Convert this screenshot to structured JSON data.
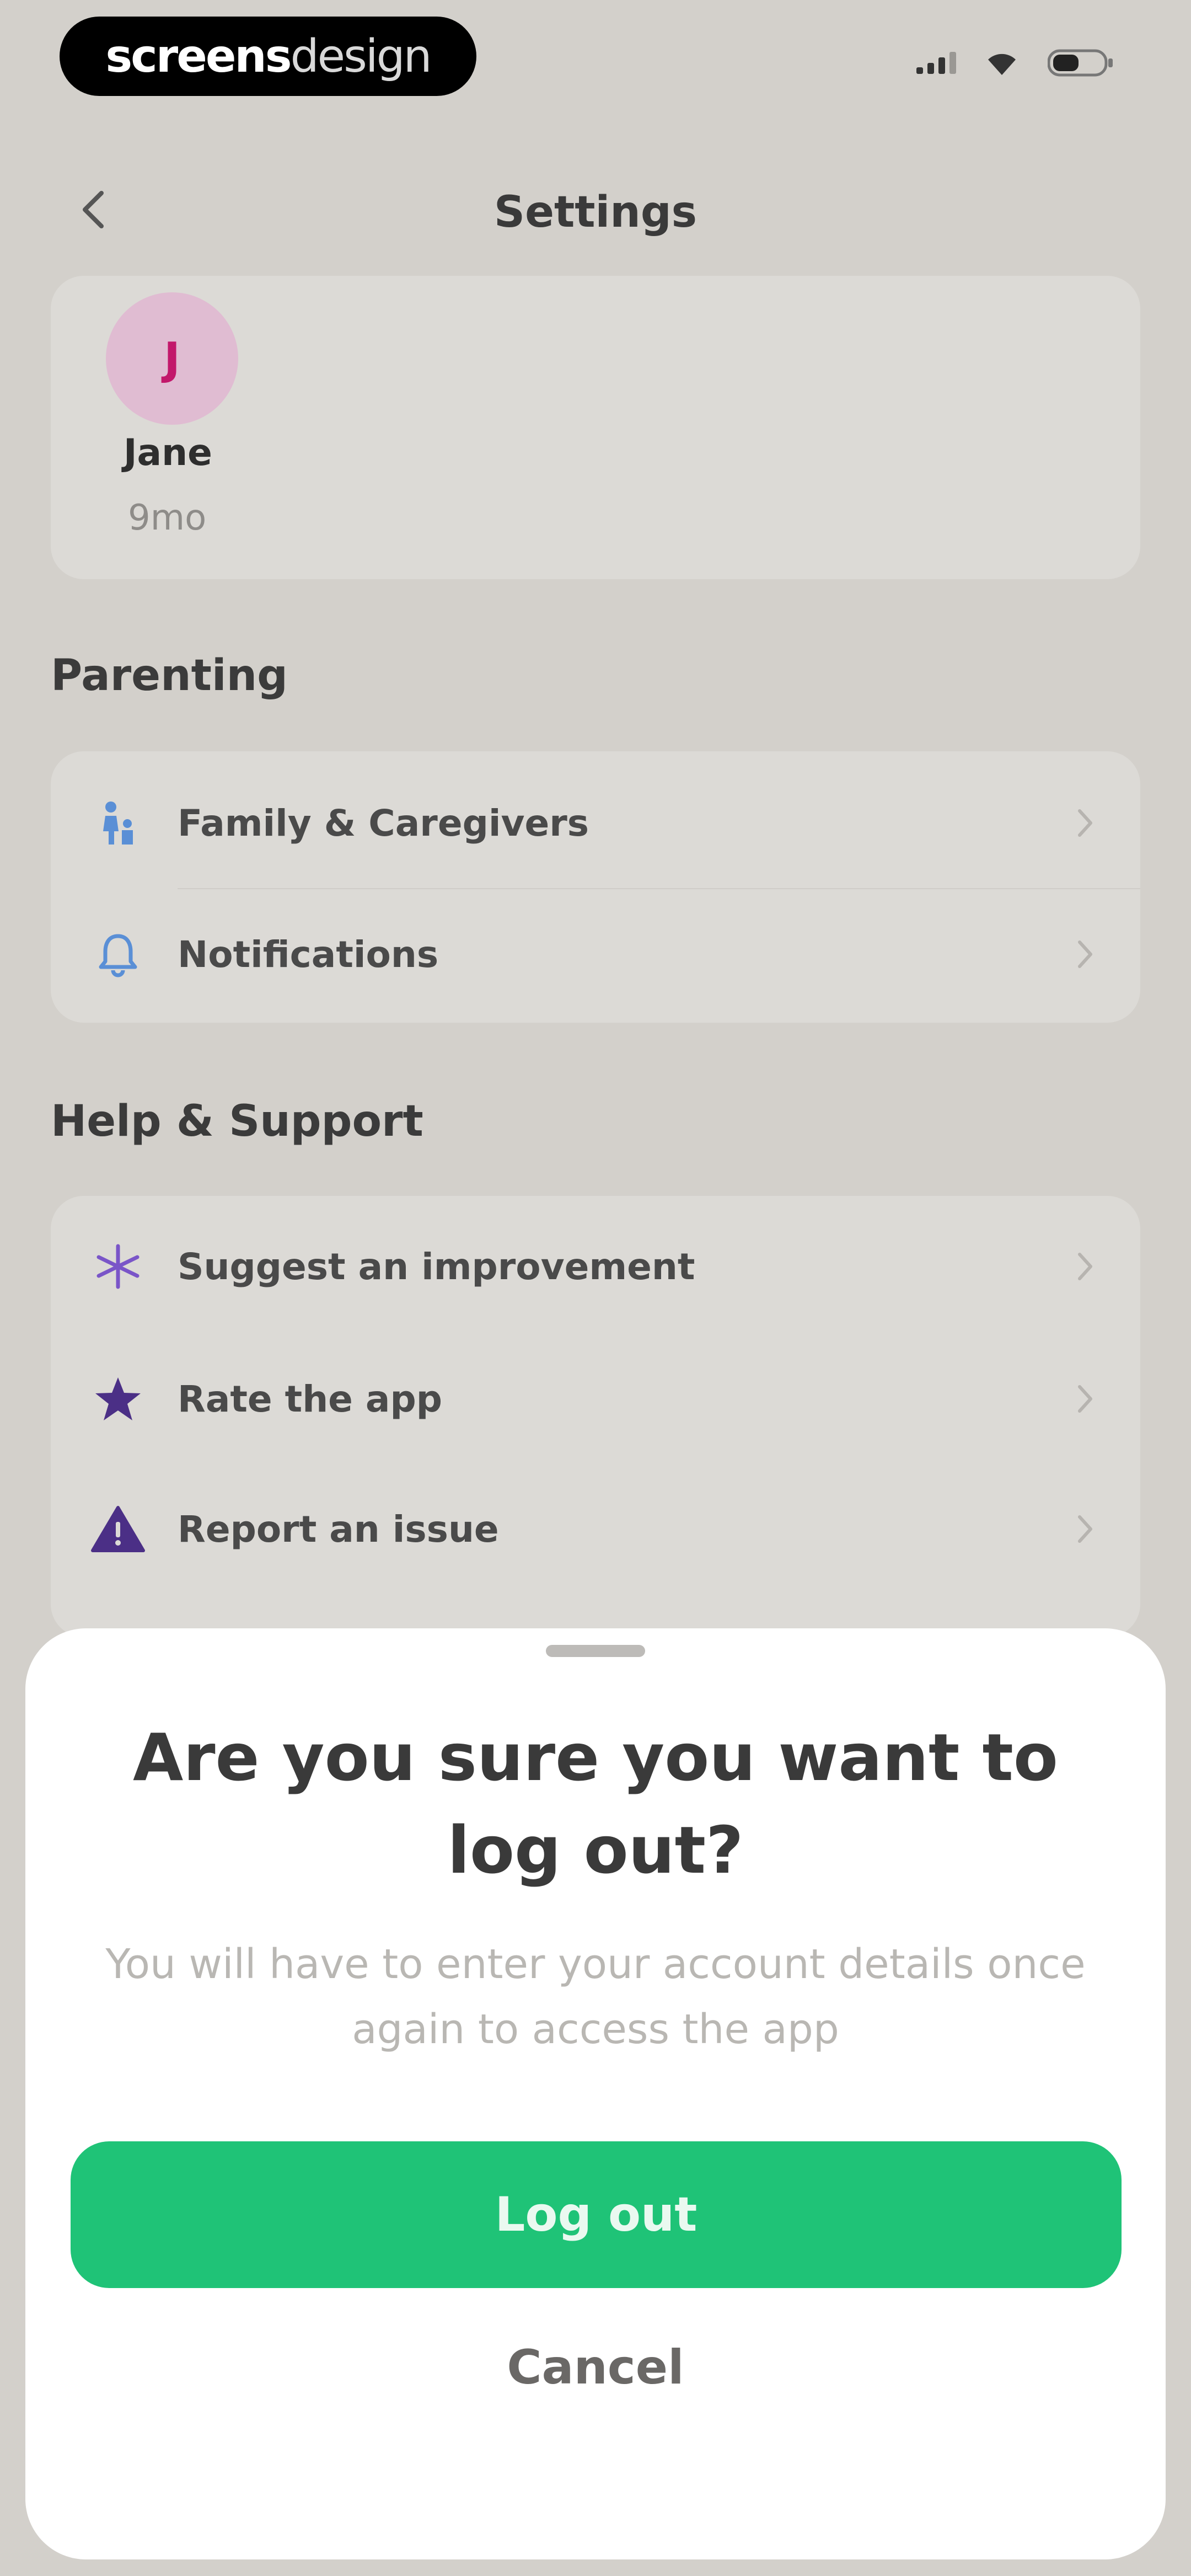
{
  "status_bar": {
    "brand_bold": "screens",
    "brand_light": "design"
  },
  "header": {
    "title": "Settings",
    "back_icon": "chevron-left-icon"
  },
  "profile": {
    "initial": "J",
    "name": "Jane",
    "subtitle": "9mo"
  },
  "sections": {
    "parenting": {
      "label": "Parenting",
      "items": [
        {
          "label": "Family & Caregivers",
          "icon": "family-icon"
        },
        {
          "label": "Notifications",
          "icon": "bell-icon"
        }
      ]
    },
    "help": {
      "label": "Help & Support",
      "items": [
        {
          "label": "Suggest an improvement",
          "icon": "sparkle-icon"
        },
        {
          "label": "Rate the app",
          "icon": "star-icon"
        },
        {
          "label": "Report an issue",
          "icon": "warning-icon"
        }
      ]
    }
  },
  "sheet": {
    "title": "Are you sure you want to log out?",
    "body": "You will have to enter your account details once again to access the app",
    "logout_label": "Log out",
    "cancel_label": "Cancel"
  },
  "colors": {
    "accent_green": "#1fc377",
    "avatar_bg": "#e0bcd2",
    "avatar_text": "#c2186b",
    "icon_blue": "#5a8fd6",
    "icon_purple": "#4b2f86"
  }
}
